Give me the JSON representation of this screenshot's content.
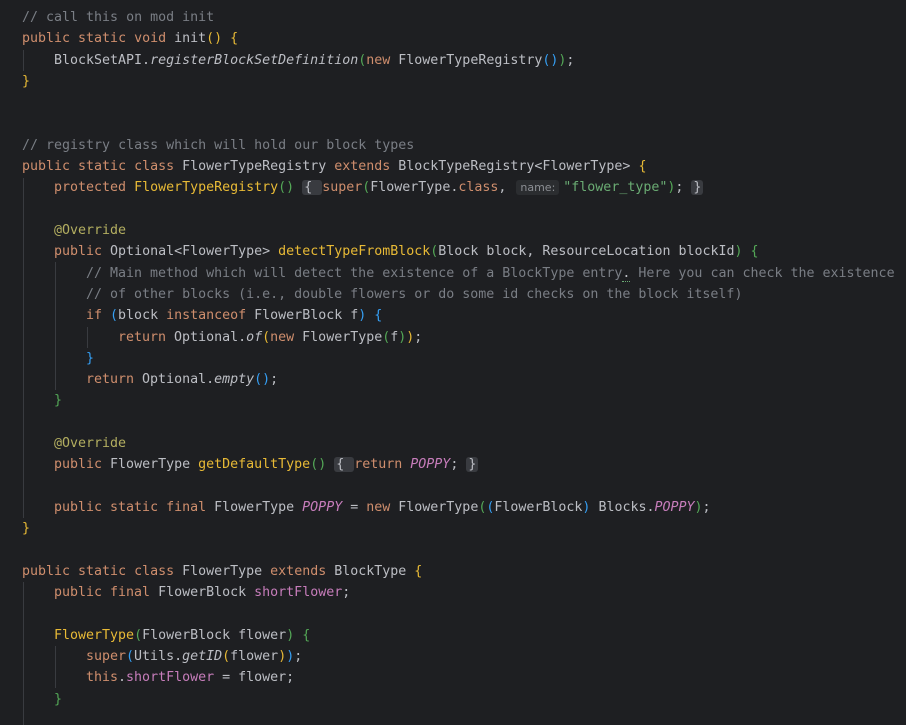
{
  "editor": {
    "colors": {
      "background": "#1e1f22",
      "text": "#bcbec4",
      "keyword": "#cf8e6d",
      "comment": "#7a7e85",
      "method": "#56a8f5",
      "string": "#6aab73",
      "annotation": "#b3ae60",
      "field": "#c77dbb"
    },
    "lines": [
      {
        "indent": 0,
        "tokens": [
          {
            "c": "cm",
            "t": "// call this on mod init"
          }
        ]
      },
      {
        "indent": 0,
        "tokens": [
          {
            "c": "kw",
            "t": "public static void "
          },
          {
            "t": "init"
          },
          {
            "c": "br1",
            "t": "()"
          },
          {
            "t": " "
          },
          {
            "c": "br1",
            "t": "{"
          }
        ]
      },
      {
        "indent": 1,
        "tokens": [
          {
            "t": "BlockSetAPI."
          },
          {
            "c": "it",
            "t": "registerBlockSetDefinition"
          },
          {
            "c": "br2",
            "t": "("
          },
          {
            "c": "kw",
            "t": "new "
          },
          {
            "t": "FlowerTypeRegistry"
          },
          {
            "c": "br3",
            "t": "()"
          },
          {
            "c": "br2",
            "t": ")"
          },
          {
            "t": ";"
          }
        ]
      },
      {
        "indent": 0,
        "tokens": [
          {
            "c": "br1",
            "t": "}"
          }
        ]
      },
      {
        "indent": 0,
        "tokens": []
      },
      {
        "indent": 0,
        "tokens": []
      },
      {
        "indent": 0,
        "tokens": [
          {
            "c": "cm",
            "t": "// registry class which will hold our block types"
          }
        ]
      },
      {
        "indent": 0,
        "tokens": [
          {
            "c": "kw",
            "t": "public static class "
          },
          {
            "t": "FlowerTypeRegistry "
          },
          {
            "c": "kw",
            "t": "extends "
          },
          {
            "t": "BlockTypeRegistry<FlowerType> "
          },
          {
            "c": "br1",
            "t": "{"
          }
        ]
      },
      {
        "indent": 1,
        "tokens": [
          {
            "c": "kw",
            "t": "protected "
          },
          {
            "c": "decl",
            "t": "FlowerTypeRegistry"
          },
          {
            "c": "br2",
            "t": "()"
          },
          {
            "t": " "
          },
          {
            "c": "fold",
            "t": "{ "
          },
          {
            "c": "kw",
            "t": "super"
          },
          {
            "c": "br2",
            "t": "("
          },
          {
            "t": "FlowerType."
          },
          {
            "c": "kw",
            "t": "class"
          },
          {
            "t": ", "
          },
          {
            "c": "hint",
            "t": "name:"
          },
          {
            "c": "st",
            "t": "\"flower_type\""
          },
          {
            "c": "br2",
            "t": ")"
          },
          {
            "t": "; "
          },
          {
            "c": "fold",
            "t": "}"
          }
        ]
      },
      {
        "indent": 0,
        "tokens": []
      },
      {
        "indent": 1,
        "tokens": [
          {
            "c": "an",
            "t": "@Override"
          }
        ]
      },
      {
        "indent": 1,
        "tokens": [
          {
            "c": "kw",
            "t": "public "
          },
          {
            "t": "Optional<FlowerType> "
          },
          {
            "c": "decl",
            "t": "detectTypeFromBlock"
          },
          {
            "c": "br2",
            "t": "("
          },
          {
            "t": "Block block, ResourceLocation blockId"
          },
          {
            "c": "br2",
            "t": ")"
          },
          {
            "t": " "
          },
          {
            "c": "br2",
            "t": "{"
          }
        ]
      },
      {
        "indent": 2,
        "tokens": [
          {
            "c": "cm",
            "t": "// Main method which will detect the existence of a BlockType entry"
          },
          {
            "c": "typo",
            "t": "."
          },
          {
            "c": "cm",
            "t": " Here you can check the existence"
          }
        ]
      },
      {
        "indent": 2,
        "tokens": [
          {
            "c": "cm",
            "t": "// of other blocks (i.e., double flowers or do some id checks on the block itself)"
          }
        ]
      },
      {
        "indent": 2,
        "tokens": [
          {
            "c": "kw",
            "t": "if "
          },
          {
            "c": "br3",
            "t": "("
          },
          {
            "t": "block "
          },
          {
            "c": "kw",
            "t": "instanceof "
          },
          {
            "t": "FlowerBlock f"
          },
          {
            "c": "br3",
            "t": ")"
          },
          {
            "t": " "
          },
          {
            "c": "br3",
            "t": "{"
          }
        ]
      },
      {
        "indent": 3,
        "tokens": [
          {
            "c": "kw",
            "t": "return "
          },
          {
            "t": "Optional."
          },
          {
            "c": "it",
            "t": "of"
          },
          {
            "c": "br1",
            "t": "("
          },
          {
            "c": "kw",
            "t": "new "
          },
          {
            "t": "FlowerType"
          },
          {
            "c": "br2",
            "t": "("
          },
          {
            "t": "f"
          },
          {
            "c": "br2",
            "t": ")"
          },
          {
            "c": "br1",
            "t": ")"
          },
          {
            "t": ";"
          }
        ]
      },
      {
        "indent": 2,
        "tokens": [
          {
            "c": "br3",
            "t": "}"
          }
        ]
      },
      {
        "indent": 2,
        "tokens": [
          {
            "c": "kw",
            "t": "return "
          },
          {
            "t": "Optional."
          },
          {
            "c": "it",
            "t": "empty"
          },
          {
            "c": "br3",
            "t": "()"
          },
          {
            "t": ";"
          }
        ]
      },
      {
        "indent": 1,
        "tokens": [
          {
            "c": "br2",
            "t": "}"
          }
        ]
      },
      {
        "indent": 0,
        "tokens": []
      },
      {
        "indent": 1,
        "tokens": [
          {
            "c": "an",
            "t": "@Override"
          }
        ]
      },
      {
        "indent": 1,
        "tokens": [
          {
            "c": "kw",
            "t": "public "
          },
          {
            "t": "FlowerType "
          },
          {
            "c": "decl",
            "t": "getDefaultType"
          },
          {
            "c": "br2",
            "t": "()"
          },
          {
            "t": " "
          },
          {
            "c": "fold",
            "t": "{ "
          },
          {
            "c": "kw",
            "t": "return "
          },
          {
            "c": "cst",
            "t": "POPPY"
          },
          {
            "t": "; "
          },
          {
            "c": "fold",
            "t": "}"
          }
        ]
      },
      {
        "indent": 0,
        "tokens": []
      },
      {
        "indent": 1,
        "tokens": [
          {
            "c": "kw",
            "t": "public static final "
          },
          {
            "t": "FlowerType "
          },
          {
            "c": "cst",
            "t": "POPPY"
          },
          {
            "t": " = "
          },
          {
            "c": "kw",
            "t": "new "
          },
          {
            "t": "FlowerType"
          },
          {
            "c": "br2",
            "t": "("
          },
          {
            "c": "br3",
            "t": "("
          },
          {
            "t": "FlowerBlock"
          },
          {
            "c": "br3",
            "t": ")"
          },
          {
            "t": " Blocks."
          },
          {
            "c": "cst",
            "t": "POPPY"
          },
          {
            "c": "br2",
            "t": ")"
          },
          {
            "t": ";"
          }
        ]
      },
      {
        "indent": 0,
        "tokens": [
          {
            "c": "br1",
            "t": "}"
          }
        ]
      },
      {
        "indent": 0,
        "tokens": []
      },
      {
        "indent": 0,
        "tokens": [
          {
            "c": "kw",
            "t": "public static class "
          },
          {
            "t": "FlowerType "
          },
          {
            "c": "kw",
            "t": "extends "
          },
          {
            "t": "BlockType "
          },
          {
            "c": "br1",
            "t": "{"
          }
        ]
      },
      {
        "indent": 1,
        "tokens": [
          {
            "c": "kw",
            "t": "public final "
          },
          {
            "t": "FlowerBlock "
          },
          {
            "c": "fld",
            "t": "shortFlower"
          },
          {
            "t": ";"
          }
        ]
      },
      {
        "indent": 0,
        "tokens": []
      },
      {
        "indent": 1,
        "tokens": [
          {
            "c": "decl",
            "t": "FlowerType"
          },
          {
            "c": "br2",
            "t": "("
          },
          {
            "t": "FlowerBlock flower"
          },
          {
            "c": "br2",
            "t": ")"
          },
          {
            "t": " "
          },
          {
            "c": "br2",
            "t": "{"
          }
        ]
      },
      {
        "indent": 2,
        "tokens": [
          {
            "c": "kw",
            "t": "super"
          },
          {
            "c": "br3",
            "t": "("
          },
          {
            "t": "Utils."
          },
          {
            "c": "it",
            "t": "getID"
          },
          {
            "c": "br1",
            "t": "("
          },
          {
            "t": "flower"
          },
          {
            "c": "br1",
            "t": ")"
          },
          {
            "c": "br3",
            "t": ")"
          },
          {
            "t": ";"
          }
        ]
      },
      {
        "indent": 2,
        "tokens": [
          {
            "c": "kw",
            "t": "this"
          },
          {
            "t": "."
          },
          {
            "c": "fld",
            "t": "shortFlower"
          },
          {
            "t": " = flower;"
          }
        ]
      },
      {
        "indent": 1,
        "tokens": [
          {
            "c": "br2",
            "t": "}"
          }
        ]
      }
    ]
  }
}
